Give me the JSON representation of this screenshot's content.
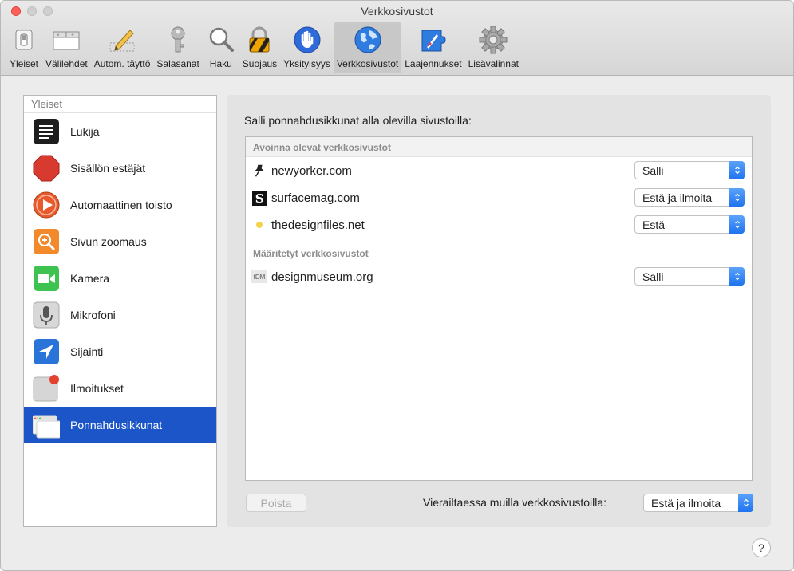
{
  "window": {
    "title": "Verkkosivustot"
  },
  "toolbar": {
    "items": [
      {
        "label": "Yleiset",
        "icon": "switch-icon"
      },
      {
        "label": "Välilehdet",
        "icon": "tabs-icon"
      },
      {
        "label": "Autom. täyttö",
        "icon": "pencil-icon"
      },
      {
        "label": "Salasanat",
        "icon": "key-icon"
      },
      {
        "label": "Haku",
        "icon": "magnifier-icon"
      },
      {
        "label": "Suojaus",
        "icon": "lock-icon"
      },
      {
        "label": "Yksityisyys",
        "icon": "hand-icon"
      },
      {
        "label": "Verkkosivustot",
        "icon": "globe-icon"
      },
      {
        "label": "Laajennukset",
        "icon": "puzzle-icon"
      },
      {
        "label": "Lisävalinnat",
        "icon": "gear-icon"
      }
    ],
    "active_index": 7
  },
  "sidebar": {
    "header": "Yleiset",
    "items": [
      {
        "label": "Lukija",
        "icon": "reader-icon"
      },
      {
        "label": "Sisällön estäjät",
        "icon": "stop-sign-icon"
      },
      {
        "label": "Automaattinen toisto",
        "icon": "play-icon"
      },
      {
        "label": "Sivun zoomaus",
        "icon": "zoom-icon"
      },
      {
        "label": "Kamera",
        "icon": "camera-icon"
      },
      {
        "label": "Mikrofoni",
        "icon": "microphone-icon"
      },
      {
        "label": "Sijainti",
        "icon": "location-icon"
      },
      {
        "label": "Ilmoitukset",
        "icon": "notifications-icon"
      },
      {
        "label": "Ponnahdusikkunat",
        "icon": "popup-window-icon"
      }
    ],
    "selected_index": 8
  },
  "main": {
    "title": "Salli ponnahdusikkunat alla olevilla sivustoilla:",
    "sections": [
      {
        "header": "Avoinna olevat verkkosivustot",
        "rows": [
          {
            "site": "newyorker.com",
            "icon": "pin-icon",
            "setting": "Salli"
          },
          {
            "site": "surfacemag.com",
            "icon": "s-logo-icon",
            "setting": "Estä ja ilmoita"
          },
          {
            "site": "thedesignfiles.net",
            "icon": "yellow-dot-icon",
            "setting": "Estä"
          }
        ]
      },
      {
        "header": "Määritetyt verkkosivustot",
        "rows": [
          {
            "site": "designmuseum.org",
            "icon": "dm-logo-icon",
            "icon_text": "tDM",
            "setting": "Salli"
          }
        ]
      }
    ],
    "remove_label": "Poista",
    "other_label": "Vierailtaessa muilla verkkosivustoilla:",
    "other_setting": "Estä ja ilmoita"
  },
  "help": {
    "label": "?"
  },
  "colors": {
    "selection": "#1b55c8",
    "stepper": "#2a7cf2",
    "close": "#fe5f57"
  }
}
